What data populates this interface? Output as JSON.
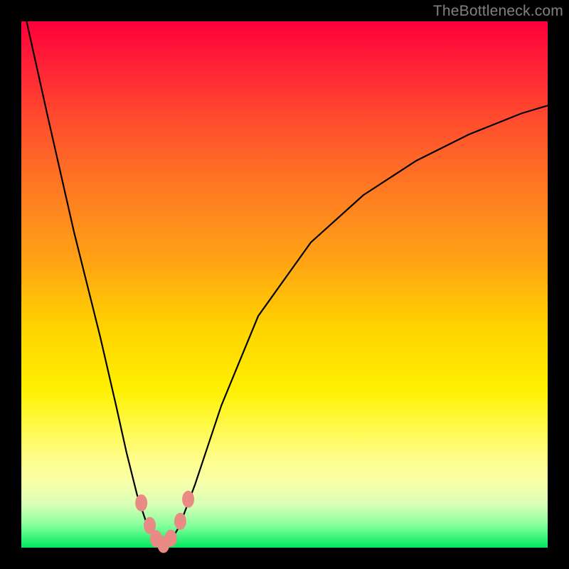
{
  "watermark": "TheBottleneck.com",
  "chart_data": {
    "type": "line",
    "title": "",
    "xlabel": "",
    "ylabel": "",
    "xlim": [
      0,
      100
    ],
    "ylim": [
      0,
      100
    ],
    "grid": false,
    "legend": false,
    "series": [
      {
        "name": "curve",
        "x": [
          1,
          5,
          10,
          15,
          18,
          20,
          22,
          24,
          25.5,
          27,
          28.5,
          30,
          33,
          38,
          45,
          55,
          65,
          75,
          85,
          95,
          100
        ],
        "y": [
          100,
          82,
          60,
          40,
          27,
          18,
          10,
          4,
          1.5,
          0.5,
          1.5,
          4,
          12,
          27,
          44,
          58,
          67,
          73.5,
          78.5,
          82.5,
          84
        ]
      }
    ],
    "markers": [
      {
        "x": 22.8,
        "y": 8.5
      },
      {
        "x": 24.4,
        "y": 4.2
      },
      {
        "x": 25.6,
        "y": 1.7
      },
      {
        "x": 27.0,
        "y": 0.6
      },
      {
        "x": 28.4,
        "y": 1.8
      },
      {
        "x": 30.2,
        "y": 5.0
      },
      {
        "x": 31.7,
        "y": 9.2
      }
    ],
    "marker_color": "#e98b84",
    "background_gradient": [
      "#ff003a",
      "#ff7a22",
      "#ffd300",
      "#fffb55",
      "#00e85e"
    ]
  }
}
